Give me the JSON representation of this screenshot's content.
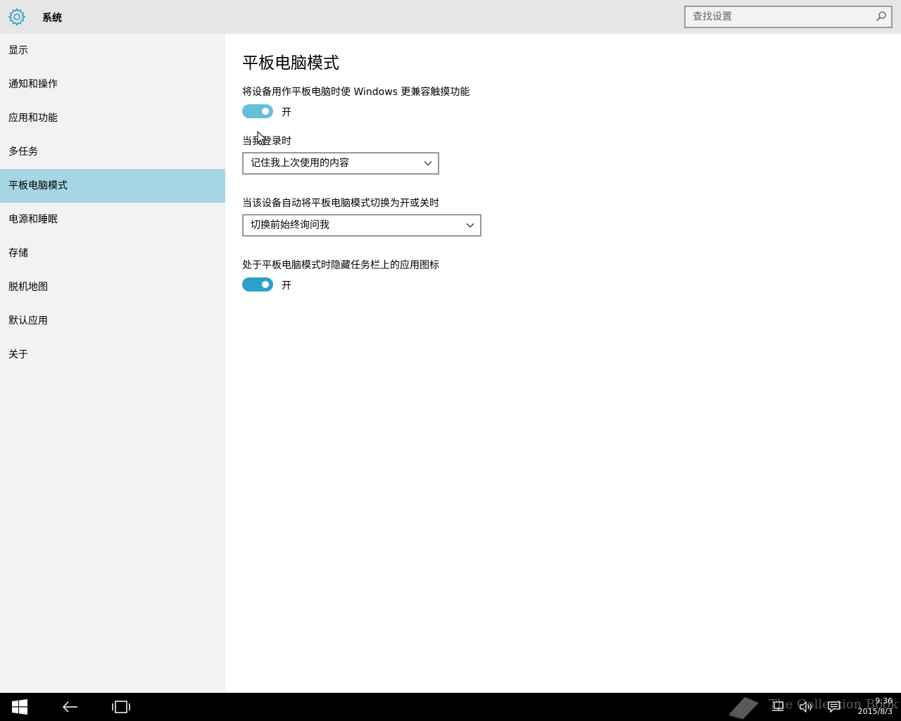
{
  "window": {
    "title": "系统",
    "search_placeholder": "查找设置"
  },
  "sidebar": {
    "items": [
      {
        "label": "显示"
      },
      {
        "label": "通知和操作"
      },
      {
        "label": "应用和功能"
      },
      {
        "label": "多任务"
      },
      {
        "label": "平板电脑模式",
        "selected": true
      },
      {
        "label": "电源和睡眠"
      },
      {
        "label": "存储"
      },
      {
        "label": "脱机地图"
      },
      {
        "label": "默认应用"
      },
      {
        "label": "关于"
      }
    ]
  },
  "main": {
    "title": "平板电脑模式",
    "touch_setting": {
      "label": "将设备用作平板电脑时使 Windows 更兼容触摸功能",
      "state": "开"
    },
    "signin_setting": {
      "label": "当我登录时",
      "value": "记住我上次使用的内容"
    },
    "auto_switch_setting": {
      "label": "当该设备自动将平板电脑模式切换为开或关时",
      "value": "切换前始终询问我"
    },
    "hide_icons_setting": {
      "label": "处于平板电脑模式时隐藏任务栏上的应用图标",
      "state": "开"
    }
  },
  "taskbar": {
    "time": "9:36",
    "date": "2015/8/3"
  },
  "watermark": {
    "text": "The Collection Book"
  },
  "colors": {
    "accent": "#2c9fcc",
    "accent_light": "#67bfdc",
    "selected_nav": "#a6d5e3",
    "sidebar_bg": "#f2f2f2",
    "titlebar_bg": "#e6e6e6",
    "taskbar_bg": "#000000"
  }
}
